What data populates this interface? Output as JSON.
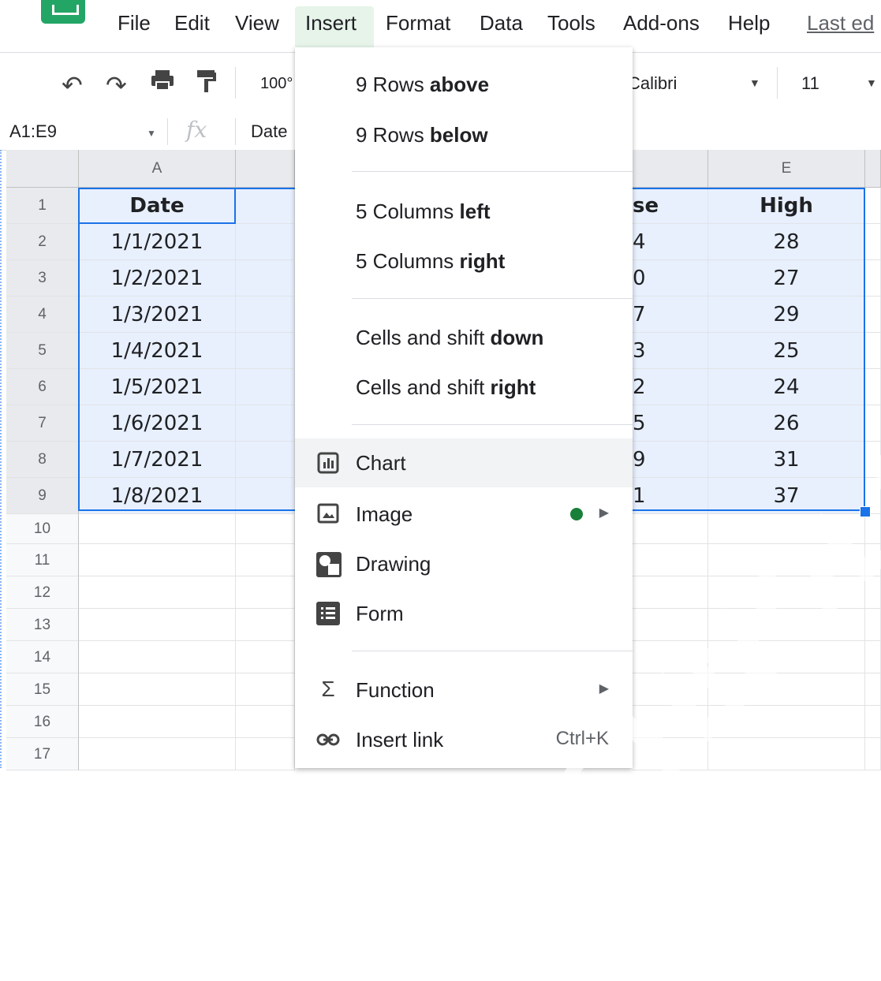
{
  "menubar": {
    "items": [
      "File",
      "Edit",
      "View",
      "Insert",
      "Format",
      "Data",
      "Tools",
      "Add-ons",
      "Help"
    ],
    "last_edit": "Last ed"
  },
  "toolbar": {
    "zoom": "100°",
    "font": "Calibri",
    "font_size": "11"
  },
  "formula_bar": {
    "name_box": "A1:E9",
    "fx": "fx",
    "content": "Date"
  },
  "grid": {
    "columns": [
      "A",
      "E"
    ],
    "row_numbers": [
      "1",
      "2",
      "3",
      "4",
      "5",
      "6",
      "7",
      "8",
      "9",
      "10",
      "11",
      "12",
      "13",
      "14",
      "15",
      "16",
      "17"
    ],
    "col_a": [
      "Date",
      "1/1/2021",
      "1/2/2021",
      "1/3/2021",
      "1/4/2021",
      "1/5/2021",
      "1/6/2021",
      "1/7/2021",
      "1/8/2021"
    ],
    "col_d_partial": [
      "se",
      "4",
      "0",
      "7",
      "3",
      "2",
      "5",
      "9",
      "1"
    ],
    "col_e": [
      "High",
      "28",
      "27",
      "29",
      "25",
      "24",
      "26",
      "31",
      "37"
    ]
  },
  "insert_menu": {
    "rows_above": {
      "prefix": "9 Rows ",
      "bold": "above"
    },
    "rows_below": {
      "prefix": "9 Rows ",
      "bold": "below"
    },
    "cols_left": {
      "prefix": "5 Columns ",
      "bold": "left"
    },
    "cols_right": {
      "prefix": "5 Columns ",
      "bold": "right"
    },
    "shift_down": {
      "prefix": "Cells and shift ",
      "bold": "down"
    },
    "shift_right": {
      "prefix": "Cells and shift ",
      "bold": "right"
    },
    "chart": "Chart",
    "image": "Image",
    "drawing": "Drawing",
    "form": "Form",
    "function": "Function",
    "insert_link": "Insert link",
    "insert_link_shortcut": "Ctrl+K"
  },
  "colors": {
    "selection": "#e8f0fe",
    "accent": "#1a73e8",
    "green_dot": "#188038"
  },
  "watermark": "TECHNOLOGY.COM"
}
